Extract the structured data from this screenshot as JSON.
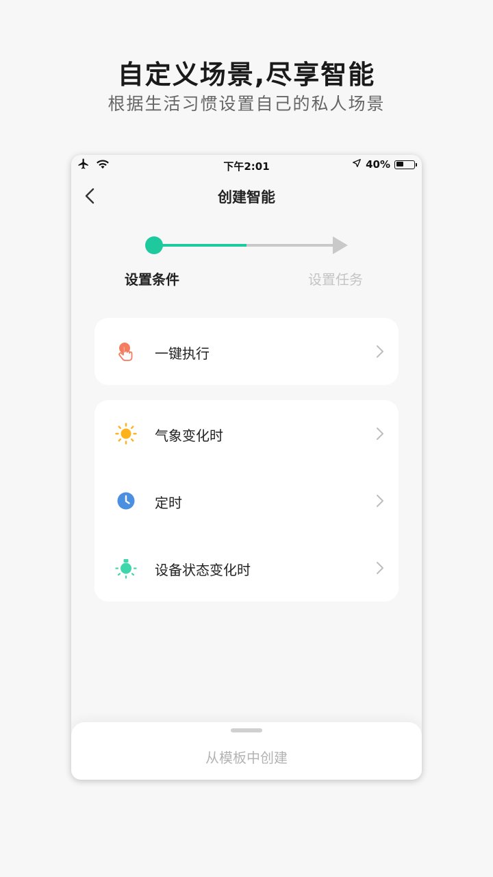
{
  "promo": {
    "title": "自定义场景,尽享智能",
    "subtitle": "根据生活习惯设置自己的私人场景"
  },
  "status_bar": {
    "time": "下午2:01",
    "battery": "40%",
    "battery_level": 0.4
  },
  "nav": {
    "title": "创建智能"
  },
  "stepper": {
    "progress": 0.5,
    "steps": [
      {
        "label": "设置条件",
        "active": true
      },
      {
        "label": "设置任务",
        "active": false
      }
    ]
  },
  "conditions": {
    "quick": {
      "label": "一键执行",
      "icon": "tap-hand-icon"
    },
    "items": [
      {
        "label": "气象变化时",
        "icon": "sun-icon"
      },
      {
        "label": "定时",
        "icon": "clock-icon"
      },
      {
        "label": "设备状态变化时",
        "icon": "device-bulb-icon"
      }
    ]
  },
  "bottom_sheet": {
    "label": "从模板中创建"
  },
  "colors": {
    "accent": "#1ec99d",
    "inactive": "#c9c9c9",
    "tap_icon": "#f47c5f",
    "sun_icon": "#ffb21a",
    "clock_icon": "#4a8fe0",
    "device_icon": "#3fd6ac"
  }
}
